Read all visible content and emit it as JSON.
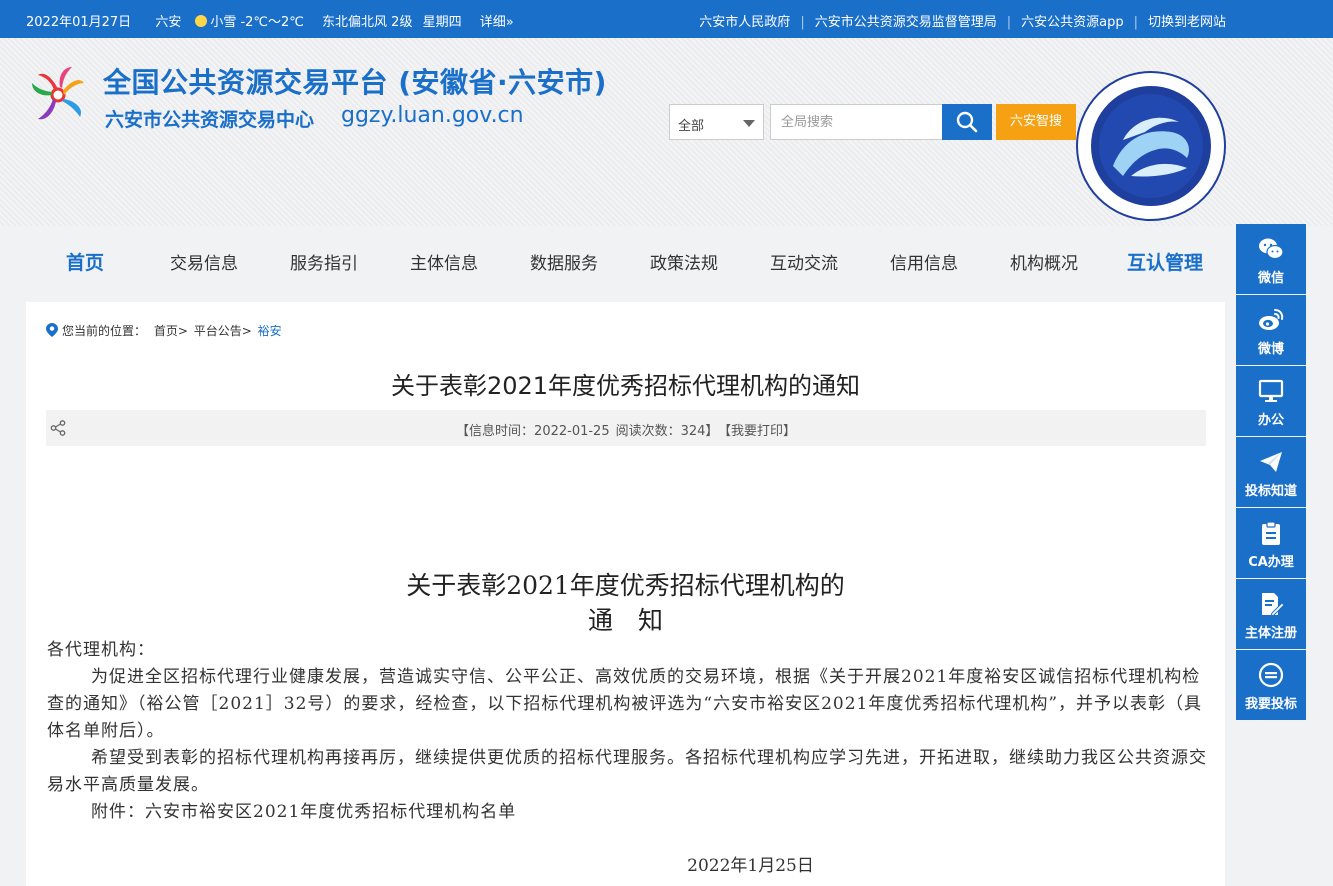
{
  "topbar": {
    "date": "2022年01月27日",
    "city": "六安",
    "weather": "小雪 -2℃～2℃",
    "wind": "东北偏北风 2级",
    "weekday": "星期四",
    "detail": "详细»",
    "links": [
      "六安市人民政府",
      "六安市公共资源交易监督管理局",
      "六安公共资源app",
      "切换到老网站"
    ]
  },
  "header": {
    "title": "全国公共资源交易平台 (安徽省·六安市)",
    "subtitle": "六安市公共资源交易中心",
    "domain": "ggzy.luan.gov.cn",
    "search_select": "全部",
    "search_placeholder": "全局搜索",
    "smart_search": "六安智搜"
  },
  "nav": [
    "首页",
    "交易信息",
    "服务指引",
    "主体信息",
    "数据服务",
    "政策法规",
    "互动交流",
    "信用信息",
    "机构概况",
    "互认管理"
  ],
  "breadcrumb": {
    "prefix": "您当前的位置：",
    "items": [
      "首页>",
      "平台公告>"
    ],
    "current": "裕安"
  },
  "article": {
    "title": "关于表彰2021年度优秀招标代理机构的通知",
    "meta_time": "【信息时间：2022-01-25",
    "meta_reads": "阅读次数：324】",
    "meta_print": "【我要打印】",
    "doc_title_line1": "关于表彰2021年度优秀招标代理机构的",
    "doc_title_line2": "通　知",
    "salutation": "各代理机构：",
    "para1": "为促进全区招标代理行业健康发展，营造诚实守信、公平公正、高效优质的交易环境，根据《关于开展2021年度裕安区诚信招标代理机构检查的通知》（裕公管［2021］32号）的要求，经检查，以下招标代理机构被评选为“六安市裕安区2021年度优秀招标代理机构”，并予以表彰（具体名单附后）。",
    "para2": "希望受到表彰的招标代理机构再接再厉，继续提供更优质的招标代理服务。各招标代理机构应学习先进，开拓进取，继续助力我区公共资源交易水平高质量发展。",
    "attachment": "附件：六安市裕安区2021年度优秀招标代理机构名单",
    "date": "2022年1月25日"
  },
  "side": [
    "微信",
    "微博",
    "办公",
    "投标知道",
    "CA办理",
    "主体注册",
    "我要投标"
  ],
  "colors": {
    "primary": "#1a6fc9",
    "accent": "#f5a113"
  }
}
